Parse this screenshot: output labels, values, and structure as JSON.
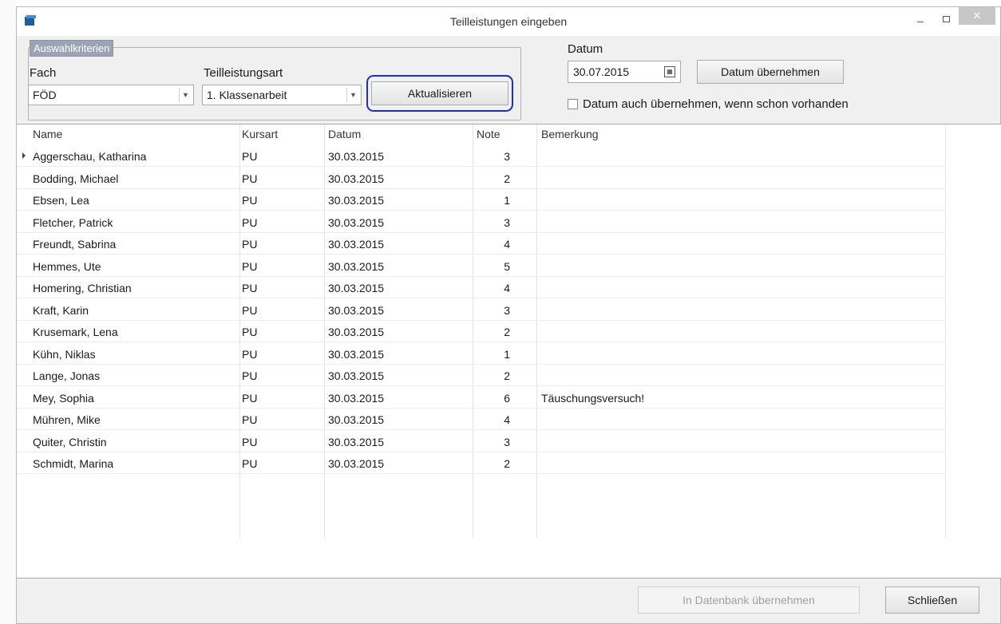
{
  "window": {
    "title": "Teilleistungen eingeben"
  },
  "selection": {
    "group_label": "Auswahlkriterien",
    "fach_label": "Fach",
    "fach_value": "FÖD",
    "art_label": "Teilleistungsart",
    "art_value": "1. Klassenarbeit",
    "refresh_label": "Aktualisieren"
  },
  "date": {
    "label": "Datum",
    "value": "30.07.2015",
    "apply_label": "Datum übernehmen",
    "overwrite_label": "Datum auch übernehmen, wenn schon vorhanden",
    "overwrite_checked": false
  },
  "grid": {
    "columns": [
      "Name",
      "Kursart",
      "Datum",
      "Note",
      "Bemerkung"
    ],
    "rows": [
      {
        "name": "Aggerschau, Katharina",
        "kursart": "PU",
        "datum": "30.03.2015",
        "note": "3",
        "bemerkung": ""
      },
      {
        "name": "Bodding, Michael",
        "kursart": "PU",
        "datum": "30.03.2015",
        "note": "2",
        "bemerkung": ""
      },
      {
        "name": "Ebsen, Lea",
        "kursart": "PU",
        "datum": "30.03.2015",
        "note": "1",
        "bemerkung": ""
      },
      {
        "name": "Fletcher, Patrick",
        "kursart": "PU",
        "datum": "30.03.2015",
        "note": "3",
        "bemerkung": ""
      },
      {
        "name": "Freundt, Sabrina",
        "kursart": "PU",
        "datum": "30.03.2015",
        "note": "4",
        "bemerkung": ""
      },
      {
        "name": "Hemmes, Ute",
        "kursart": "PU",
        "datum": "30.03.2015",
        "note": "5",
        "bemerkung": ""
      },
      {
        "name": "Homering, Christian",
        "kursart": "PU",
        "datum": "30.03.2015",
        "note": "4",
        "bemerkung": ""
      },
      {
        "name": "Kraft, Karin",
        "kursart": "PU",
        "datum": "30.03.2015",
        "note": "3",
        "bemerkung": ""
      },
      {
        "name": "Krusemark, Lena",
        "kursart": "PU",
        "datum": "30.03.2015",
        "note": "2",
        "bemerkung": ""
      },
      {
        "name": "Kühn, Niklas",
        "kursart": "PU",
        "datum": "30.03.2015",
        "note": "1",
        "bemerkung": ""
      },
      {
        "name": "Lange, Jonas",
        "kursart": "PU",
        "datum": "30.03.2015",
        "note": "2",
        "bemerkung": ""
      },
      {
        "name": "Mey, Sophia",
        "kursart": "PU",
        "datum": "30.03.2015",
        "note": "6",
        "bemerkung": "Täuschungsversuch!"
      },
      {
        "name": "Mühren, Mike",
        "kursart": "PU",
        "datum": "30.03.2015",
        "note": "4",
        "bemerkung": ""
      },
      {
        "name": "Quiter, Christin",
        "kursart": "PU",
        "datum": "30.03.2015",
        "note": "3",
        "bemerkung": ""
      },
      {
        "name": "Schmidt, Marina",
        "kursart": "PU",
        "datum": "30.03.2015",
        "note": "2",
        "bemerkung": ""
      }
    ]
  },
  "footer": {
    "save_label": "In Datenbank übernehmen",
    "close_label": "Schließen"
  },
  "icons": {
    "app": "app-icon",
    "minimize": "minimize-icon",
    "maximize": "maximize-icon",
    "close": "close-icon",
    "calendar": "calendar-icon",
    "dropdown": "chevron-down-icon"
  },
  "colors": {
    "focus_ring": "#1d2fbf",
    "app_icon": "#1b5f9e"
  }
}
